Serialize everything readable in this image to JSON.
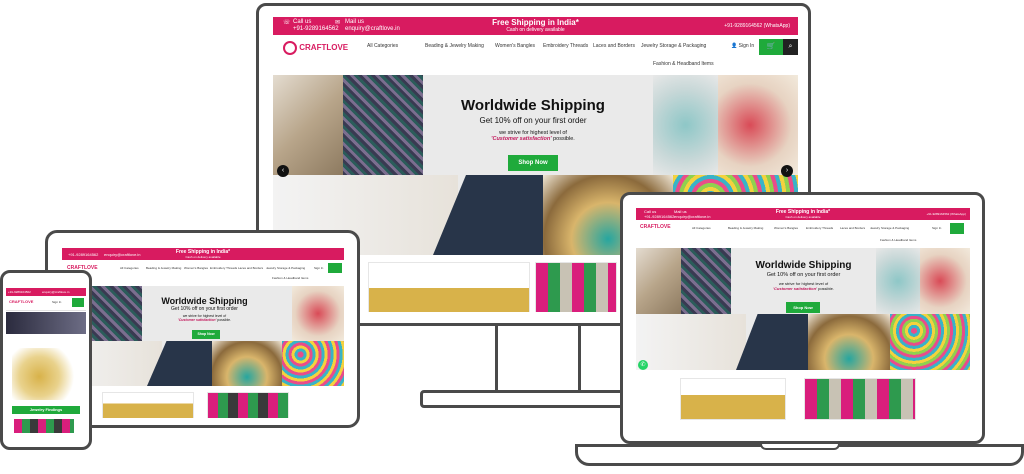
{
  "site": {
    "brand": "CRAFTLOVE",
    "call_label": "Call us",
    "phone": "+91-9289164562",
    "mail_label": "Mail us",
    "email": "enquiry@craftlove.in",
    "banner_title": "Free Shipping in India*",
    "banner_sub": "Cash on delivery available",
    "whatsapp": "+91-9289164562 (WhatsApp)",
    "nav": [
      "All Categories",
      "Beading & Jewelry Making",
      "Women's Bangles",
      "Embroidery Threads",
      "Laces and Borders",
      "Jewelry Storage & Packaging",
      "Fashion & Headband Items"
    ],
    "signin": "Sign In",
    "cart_count": "0"
  },
  "hero": {
    "title": "Worldwide Shipping",
    "subtitle": "Get 10% off on your first order",
    "line1": "we strive for highest level of",
    "highlight": "'Customer satisfaction'",
    "line2": " possible.",
    "cta": "Shop Now"
  },
  "phone_screen": {
    "product_label": "Jewelry Findings"
  },
  "colors": {
    "brand_pink": "#d81b60",
    "cta_green": "#1faa3b"
  }
}
